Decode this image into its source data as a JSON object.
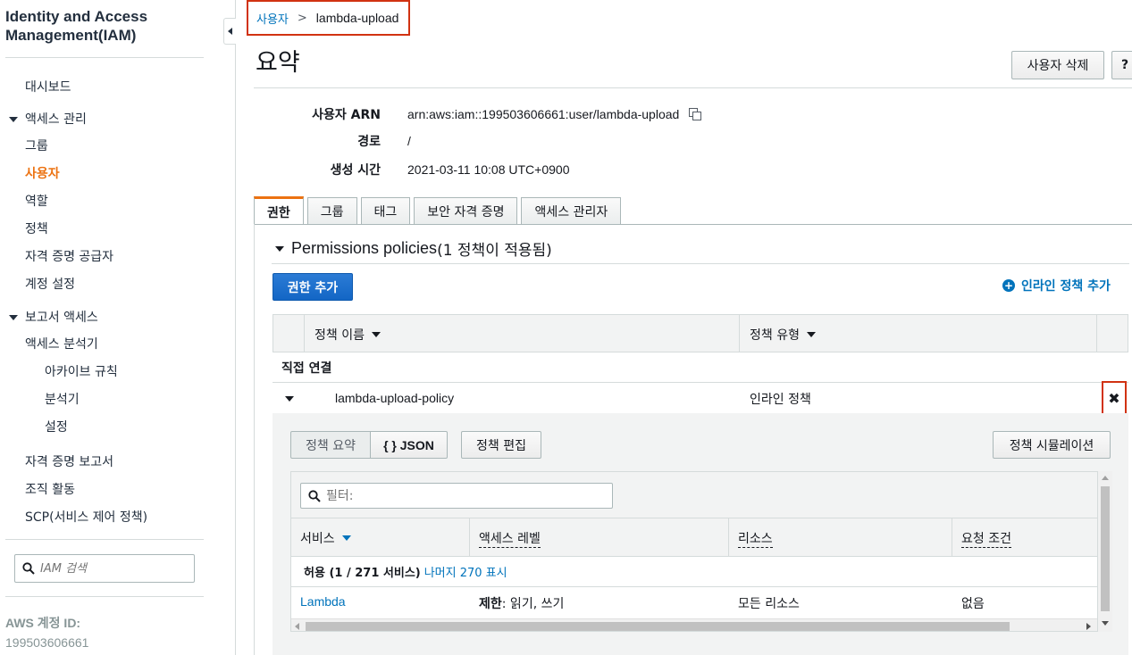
{
  "sidebar": {
    "title": "Identity and Access Management(IAM)",
    "dashboard": "대시보드",
    "access_mgmt": "액세스 관리",
    "groups": "그룹",
    "users": "사용자",
    "roles": "역할",
    "policies": "정책",
    "identity_providers": "자격 증명 공급자",
    "account_settings": "계정 설정",
    "report_access": "보고서 액세스",
    "access_analyzer": "액세스 분석기",
    "archive_rules": "아카이브 규칙",
    "analyzers": "분석기",
    "settings": "설정",
    "credential_report": "자격 증명 보고서",
    "org_activity": "조직 활동",
    "scp": "SCP(서비스 제어 정책)",
    "search_placeholder": "IAM 검색",
    "account_id_label": "AWS 계정 ID:",
    "account_id": "199503606661"
  },
  "breadcrumb": {
    "parent": "사용자",
    "separator": ">",
    "current": "lambda-upload"
  },
  "header": {
    "title": "요약",
    "delete_button": "사용자 삭제",
    "help_button": "?"
  },
  "summary": {
    "arn_label": "사용자 ARN",
    "arn_value": "arn:aws:iam::199503606661:user/lambda-upload",
    "path_label": "경로",
    "path_value": "/",
    "created_label": "생성 시간",
    "created_value": "2021-03-11 10:08 UTC+0900"
  },
  "tabs": [
    "권한",
    "그룹",
    "태그",
    "보안 자격 증명",
    "액세스 관리자"
  ],
  "permissions": {
    "section_title": "Permissions policies",
    "section_count": " (1 정책이 적용됨)",
    "add_button": "권한 추가",
    "inline_add": "인라인 정책 추가",
    "col_name": "정책 이름",
    "col_type": "정책 유형",
    "group_label": "직접 연결",
    "policy_name": "lambda-upload-policy",
    "policy_type": "인라인 정책",
    "remove_icon": "✖"
  },
  "policy_detail": {
    "summary_btn": "정책 요약",
    "json_btn": "{ } JSON",
    "edit_btn": "정책 편집",
    "simulate_btn": "정책 시뮬레이션",
    "filter_placeholder": "필터:",
    "col_service": "서비스",
    "col_access": "액세스 레벨",
    "col_resource": "리소스",
    "col_condition": "요청 조건",
    "allow_text": "허용 (1 / 271 서비스)",
    "show_rest": "나머지 270 표시",
    "row": {
      "service": "Lambda",
      "access_strong": "제한",
      "access_rest": ": 읽기, 쓰기",
      "resource": "모든 리소스",
      "condition": "없음"
    }
  },
  "colors": {
    "accent": "#ec7211",
    "link": "#0073bb",
    "primary": "#1366c5",
    "highlight": "#d13212"
  }
}
